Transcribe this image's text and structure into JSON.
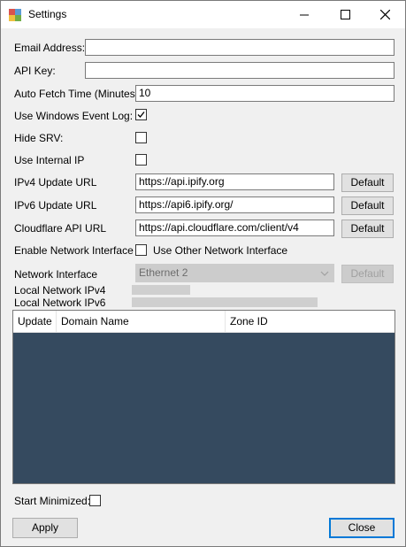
{
  "window": {
    "title": "Settings"
  },
  "fields": {
    "email_label": "Email Address:",
    "email_value": "",
    "api_key_label": "API Key:",
    "api_key_value": "",
    "auto_fetch_label": "Auto Fetch Time (Minutes):",
    "auto_fetch_value": "10",
    "event_log_label": "Use Windows Event Log:",
    "hide_srv_label": "Hide SRV:",
    "internal_ip_label": "Use Internal IP",
    "ipv4_label": "IPv4 Update URL",
    "ipv4_value": "https://api.ipify.org",
    "ipv6_label": "IPv6 Update URL",
    "ipv6_value": "https://api6.ipify.org/",
    "cf_api_label": "Cloudflare API URL",
    "cf_api_value": "https://api.cloudflare.com/client/v4",
    "default_label": "Default",
    "enable_netif_label": "Enable Network Interface",
    "use_other_netif_label": "Use Other Network Interface",
    "netif_label": "Network Interface",
    "netif_value": "Ethernet 2",
    "local_ipv4_label": "Local Network IPv4",
    "local_ipv6_label": "Local Network IPv6",
    "start_minimized_label": "Start Minimized:"
  },
  "checkboxes": {
    "event_log": true,
    "hide_srv": false,
    "internal_ip": false,
    "use_other_netif": false,
    "start_minimized": false
  },
  "grid": {
    "columns": [
      "Update",
      "Domain Name",
      "Zone ID"
    ],
    "background": "#354a5f"
  },
  "buttons": {
    "apply": "Apply",
    "close": "Close"
  },
  "colors": {
    "accent": "#0078d7"
  }
}
